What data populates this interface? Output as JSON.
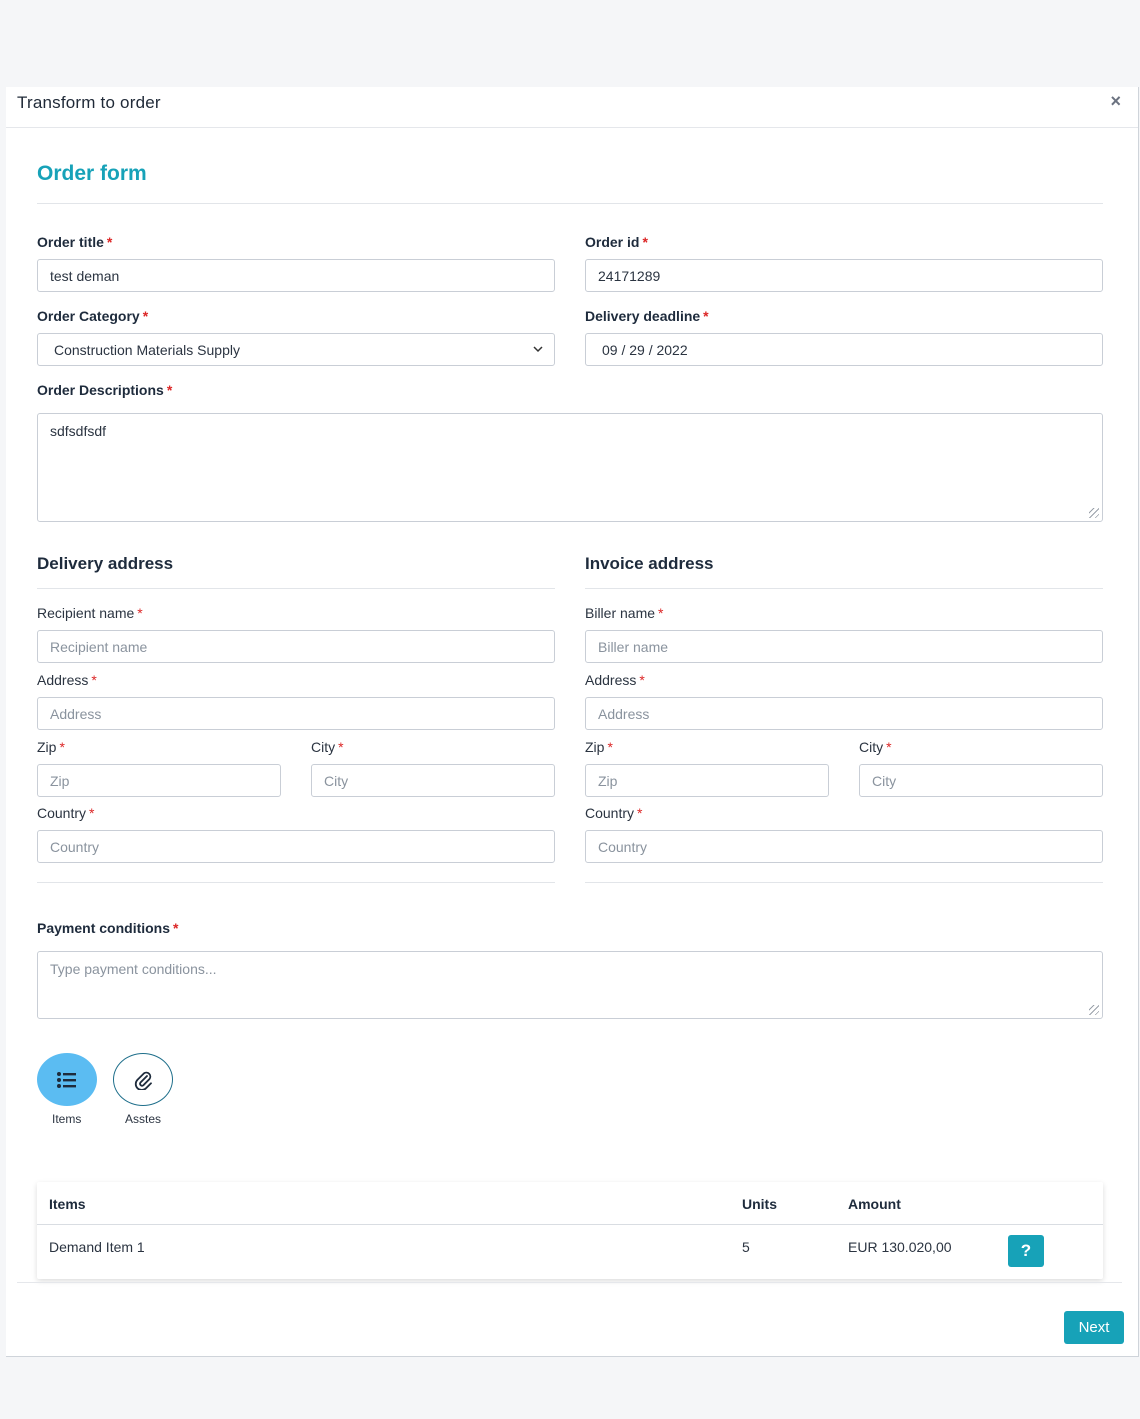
{
  "modal": {
    "title": "Transform to order",
    "close_label": "×"
  },
  "form": {
    "section_title": "Order form",
    "order_title": {
      "label": "Order title",
      "value": "test deman"
    },
    "order_id": {
      "label": "Order id",
      "value": "24171289"
    },
    "order_category": {
      "label": "Order Category",
      "value": "Construction Materials Supply"
    },
    "delivery_deadline": {
      "label": "Delivery deadline",
      "value": "09 / 29 / 2022"
    },
    "order_descriptions": {
      "label": "Order Descriptions",
      "value": "sdfsdfsdf"
    },
    "required_mark": "*"
  },
  "delivery": {
    "title": "Delivery address",
    "recipient": {
      "label": "Recipient name",
      "placeholder": "Recipient name"
    },
    "address": {
      "label": "Address",
      "placeholder": "Address"
    },
    "zip": {
      "label": "Zip",
      "placeholder": "Zip"
    },
    "city": {
      "label": "City",
      "placeholder": "City"
    },
    "country": {
      "label": "Country",
      "placeholder": "Country"
    }
  },
  "invoice": {
    "title": "Invoice address",
    "biller": {
      "label": "Biller name",
      "placeholder": "Biller name"
    },
    "address": {
      "label": "Address",
      "placeholder": "Address"
    },
    "zip": {
      "label": "Zip",
      "placeholder": "Zip"
    },
    "city": {
      "label": "City",
      "placeholder": "City"
    },
    "country": {
      "label": "Country",
      "placeholder": "Country"
    }
  },
  "payment": {
    "label": "Payment conditions",
    "placeholder": "Type payment conditions..."
  },
  "tabs": {
    "items_label": "Items",
    "assets_label": "Asstes"
  },
  "items_table": {
    "headers": {
      "items": "Items",
      "units": "Units",
      "amount": "Amount"
    },
    "rows": [
      {
        "item": "Demand Item 1",
        "units": "5",
        "amount": "EUR 130.020,00",
        "help": "?"
      }
    ]
  },
  "footer": {
    "next_label": "Next"
  },
  "colors": {
    "accent": "#17a2b8",
    "active_tab": "#5bbcf2",
    "required": "#dc2626"
  }
}
